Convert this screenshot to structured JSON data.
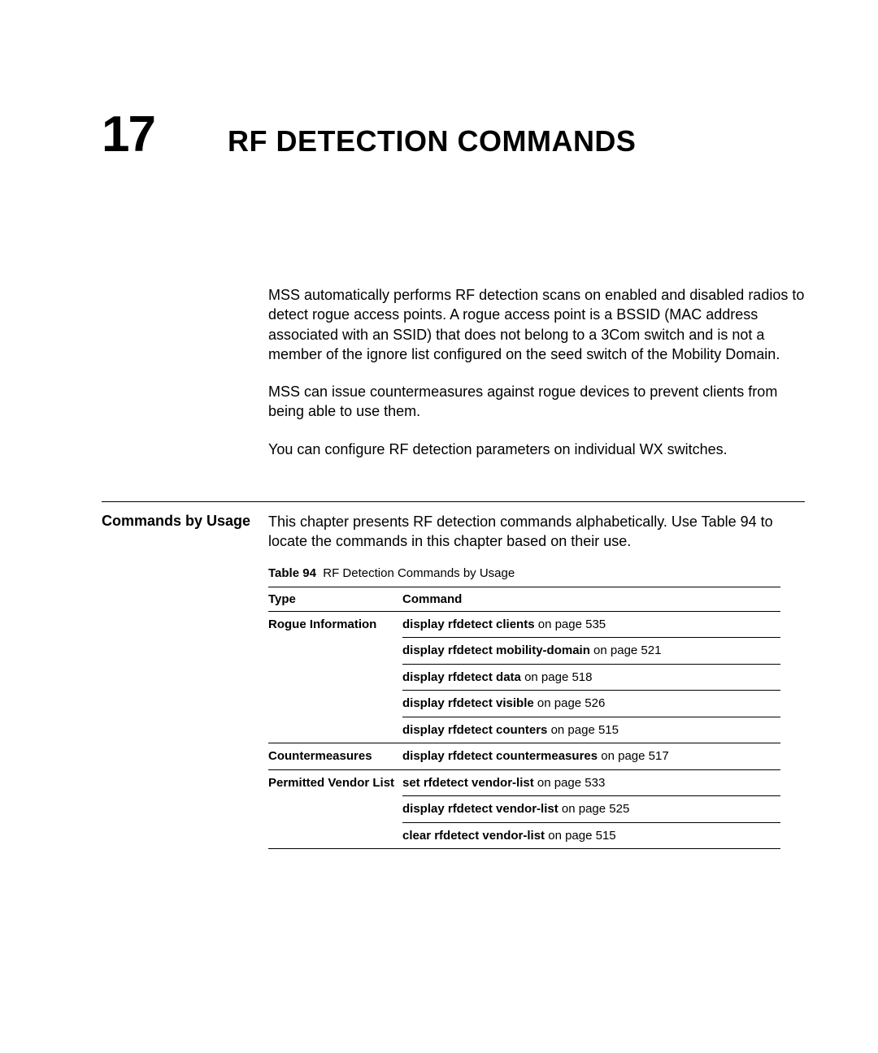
{
  "chapter": {
    "number": "17",
    "title": "RF DETECTION COMMANDS"
  },
  "intro": {
    "p1": "MSS automatically performs RF detection scans on enabled and disabled radios to detect rogue access points. A rogue access point is a BSSID (MAC address associated with an SSID) that does not belong to a 3Com switch and is not a member of the ignore list configured on the seed switch of the Mobility Domain.",
    "p2": "MSS can issue countermeasures against rogue devices to prevent clients from being able to use them.",
    "p3": "You can configure RF detection parameters on individual WX switches."
  },
  "section": {
    "label": "Commands by Usage",
    "intro": "This chapter presents RF detection commands alphabetically. Use Table 94 to locate the commands in this chapter based on their use.",
    "table_caption_label": "Table 94",
    "table_caption_text": "RF Detection Commands by Usage",
    "headers": {
      "type": "Type",
      "command": "Command"
    },
    "rows": [
      {
        "type": "Rogue Information",
        "cmd": "display rfdetect clients",
        "page": "on page 535"
      },
      {
        "type": "",
        "cmd": "display rfdetect mobility-domain",
        "page": "on page 521"
      },
      {
        "type": "",
        "cmd": "display rfdetect data",
        "page": "on page 518"
      },
      {
        "type": "",
        "cmd": "display rfdetect visible",
        "page": "on page 526"
      },
      {
        "type": "",
        "cmd": "display rfdetect counters",
        "page": "on page 515"
      },
      {
        "type": "Countermeasures",
        "cmd": "display rfdetect countermeasures",
        "page": "on page 517"
      },
      {
        "type": "Permitted Vendor List",
        "cmd": "set rfdetect vendor-list",
        "page": "on page 533"
      },
      {
        "type": "",
        "cmd": "display rfdetect vendor-list",
        "page": "on page 525"
      },
      {
        "type": "",
        "cmd": "clear rfdetect vendor-list",
        "page": "on page 515"
      }
    ]
  }
}
